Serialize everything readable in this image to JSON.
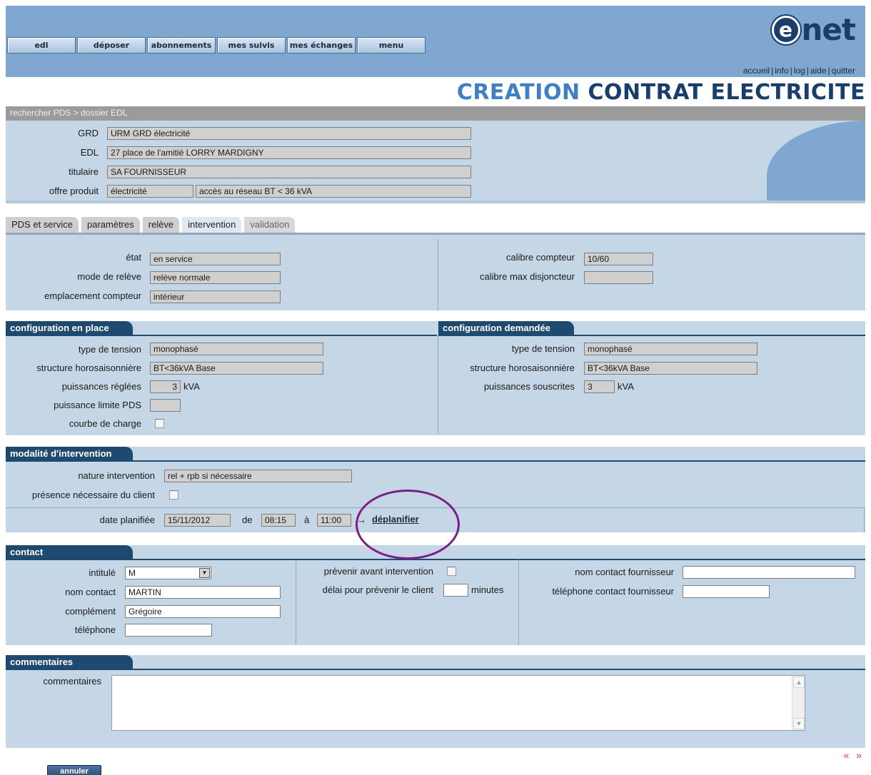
{
  "nav": {
    "buttons": [
      {
        "label": "edl"
      },
      {
        "label": "déposer"
      },
      {
        "label": "abonnements"
      },
      {
        "label": "mes suivis"
      },
      {
        "label": "mes échanges"
      },
      {
        "label": "menu"
      }
    ],
    "links": [
      "accueil",
      "info",
      "log",
      "aide",
      "quitter"
    ]
  },
  "brand": {
    "logo_e": "e",
    "logo_text": "net"
  },
  "title": {
    "part1": "CREATION",
    "part2": "CONTRAT ELECTRICITE"
  },
  "breadcrumb": "rechercher PDS > dossier EDL",
  "dossier": {
    "grd_label": "GRD",
    "grd_value": "URM GRD électricité",
    "edl_label": "EDL",
    "edl_value": "27 place de l'amitié LORRY MARDIGNY",
    "titulaire_label": "titulaire",
    "titulaire_value": "SA FOURNISSEUR",
    "offre_label": "offre produit",
    "offre_value1": "électricité",
    "offre_value2": "accès au réseau BT < 36 kVA"
  },
  "tabs": [
    {
      "label": "PDS et service"
    },
    {
      "label": "paramètres"
    },
    {
      "label": "relève"
    },
    {
      "label": "intervention"
    },
    {
      "label": "validation"
    }
  ],
  "compteur": {
    "etat_label": "état",
    "etat_value": "en service",
    "mode_label": "mode de relève",
    "mode_value": "relève normale",
    "emplacement_label": "emplacement compteur",
    "emplacement_value": "intérieur",
    "calibre_label": "calibre compteur",
    "calibre_value": "10/60",
    "disjoncteur_label": "calibre max disjoncteur",
    "disjoncteur_value": ""
  },
  "config_place": {
    "title": "configuration en place",
    "tension_label": "type de tension",
    "tension_value": "monophasé",
    "structure_label": "structure horosaisonnière",
    "structure_value": "BT<36kVA Base",
    "puissances_label": "puissances réglées",
    "puissances_value": "3",
    "unit": "kVA",
    "limite_label": "puissance limite PDS",
    "limite_value": "",
    "courbe_label": "courbe de charge"
  },
  "config_demandee": {
    "title": "configuration demandée",
    "tension_label": "type de tension",
    "tension_value": "monophasé",
    "structure_label": "structure horosaisonnière",
    "structure_value": "BT<36kVA Base",
    "puissances_label": "puissances souscrites",
    "puissances_value": "3",
    "unit": "kVA"
  },
  "intervention": {
    "title": "modalité d'intervention",
    "nature_label": "nature intervention",
    "nature_value": "rel + rpb si nécessaire",
    "presence_label": "présence nécessaire du client",
    "date_label": "date planifiée",
    "date_value": "15/11/2012",
    "de_label": "de",
    "de_value": "08:15",
    "a_label": "à",
    "a_value": "11:00",
    "arrow": "→",
    "deplanifier": "déplanifier"
  },
  "contact": {
    "title": "contact",
    "intitule_label": "intitulé",
    "intitule_value": "M",
    "nom_label": "nom contact",
    "nom_value": "MARTIN",
    "complement_label": "complément",
    "complement_value": "Grégoire",
    "telephone_label": "téléphone",
    "telephone_value": "",
    "prevenir_label": "prévenir avant intervention",
    "delai_label": "délai pour prévenir le client",
    "delai_value": "",
    "delai_unit": "minutes",
    "fournisseur_nom_label": "nom contact fournisseur",
    "fournisseur_nom_value": "",
    "fournisseur_tel_label": "téléphone contact fournisseur",
    "fournisseur_tel_value": ""
  },
  "commentaires": {
    "title": "commentaires",
    "label": "commentaires",
    "value": ""
  },
  "footer": {
    "pager": "« »",
    "annuler": "annuler"
  }
}
